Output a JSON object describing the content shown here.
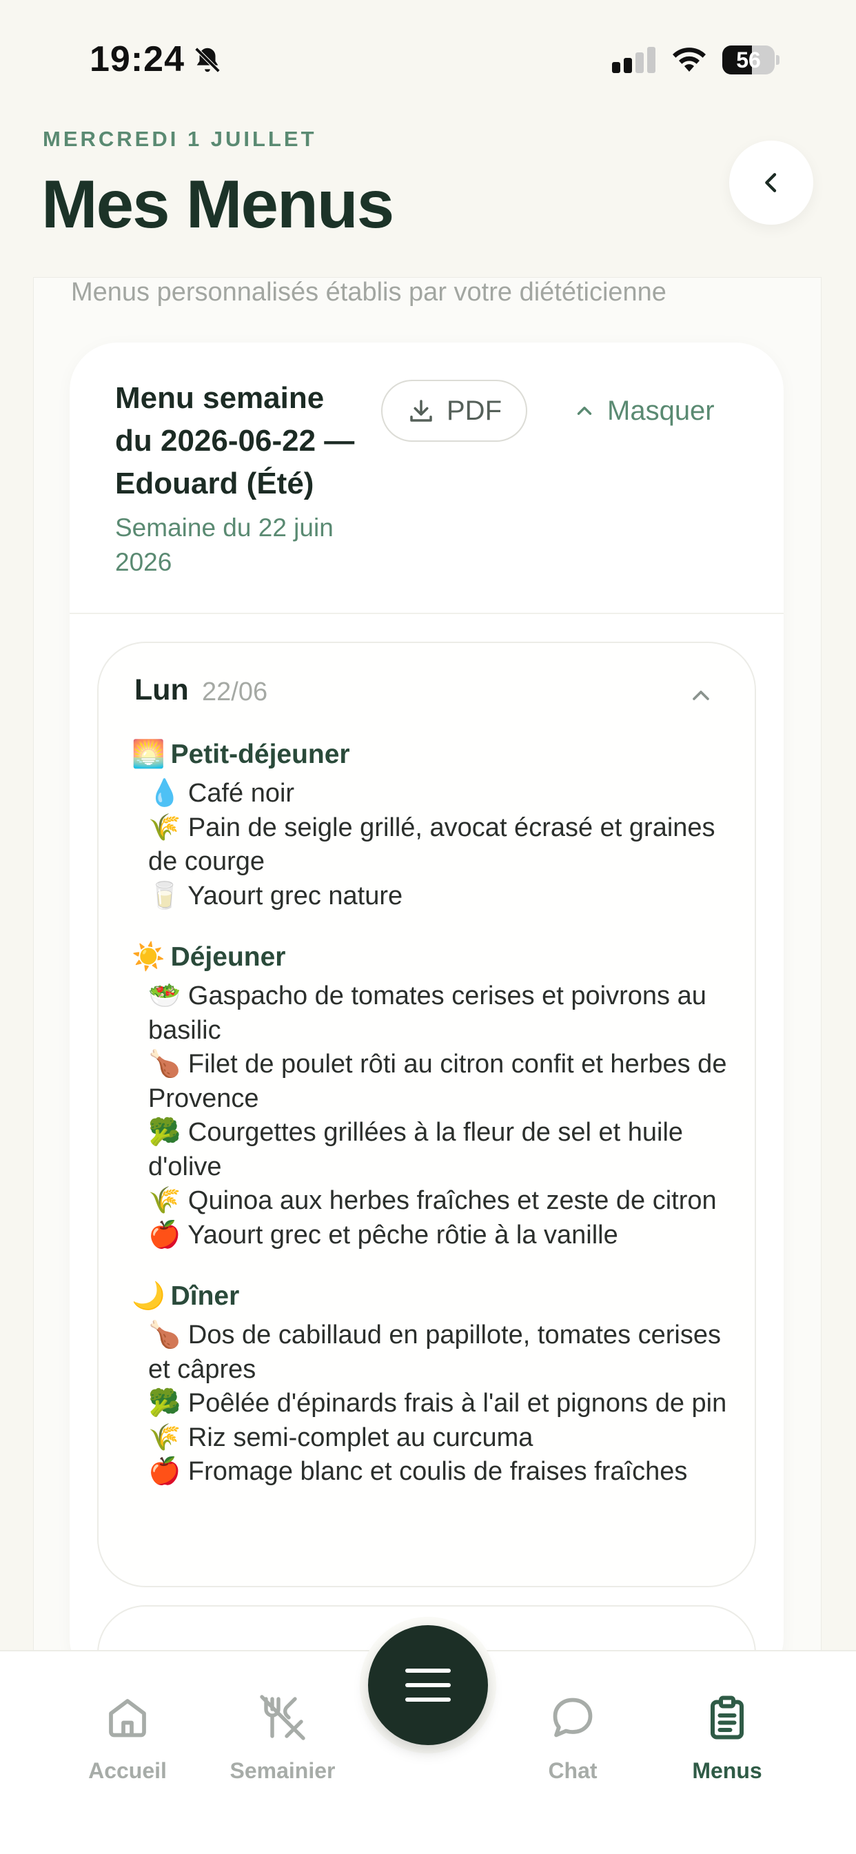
{
  "status_bar": {
    "time": "19:24",
    "battery": "56",
    "battery_level": 0.56
  },
  "header": {
    "date": "MERCREDI 1 JUILLET",
    "title": "Mes Menus",
    "subtitle": "Menus personnalisés établis par votre diététicienne"
  },
  "menu": {
    "title": "Menu semaine du 2026-06-22 — Edouard (Été)",
    "week_label": "Semaine du 22 juin 2026",
    "pdf_label": "PDF",
    "hide_label": "Masquer"
  },
  "day": {
    "name": "Lun",
    "date": "22/06",
    "meals": [
      {
        "emoji": "🌅",
        "label": "Petit-déjeuner",
        "items": [
          {
            "emoji": "💧",
            "text": "Café noir"
          },
          {
            "emoji": "🌾",
            "text": "Pain de seigle grillé, avocat écrasé et graines de courge"
          },
          {
            "emoji": "🥛",
            "text": "Yaourt grec nature"
          }
        ]
      },
      {
        "emoji": "☀️",
        "label": "Déjeuner",
        "items": [
          {
            "emoji": "🥗",
            "text": "Gaspacho de tomates cerises et poivrons au basilic"
          },
          {
            "emoji": "🍗",
            "text": "Filet de poulet rôti au citron confit et herbes de Provence"
          },
          {
            "emoji": "🥦",
            "text": "Courgettes grillées à la fleur de sel et huile d'olive"
          },
          {
            "emoji": "🌾",
            "text": "Quinoa aux herbes fraîches et zeste de citron"
          },
          {
            "emoji": "🍎",
            "text": "Yaourt grec et pêche rôtie à la vanille"
          }
        ]
      },
      {
        "emoji": "🌙",
        "label": "Dîner",
        "items": [
          {
            "emoji": "🍗",
            "text": "Dos de cabillaud en papillote, tomates cerises et câpres"
          },
          {
            "emoji": "🥦",
            "text": "Poêlée d'épinards frais à l'ail et pignons de pin"
          },
          {
            "emoji": "🌾",
            "text": "Riz semi-complet au curcuma"
          },
          {
            "emoji": "🍎",
            "text": "Fromage blanc et coulis de fraises fraîches"
          }
        ]
      }
    ]
  },
  "tabs": [
    {
      "label": "Accueil",
      "icon": "home-icon"
    },
    {
      "label": "Semainier",
      "icon": "utensils-off-icon"
    },
    {
      "label": "Chat",
      "icon": "chat-icon"
    },
    {
      "label": "Menus",
      "icon": "clipboard-icon",
      "active": true
    }
  ],
  "colors": {
    "accent": "#2f5b46",
    "fab": "#1c2f26",
    "muted": "#a7aca8"
  }
}
